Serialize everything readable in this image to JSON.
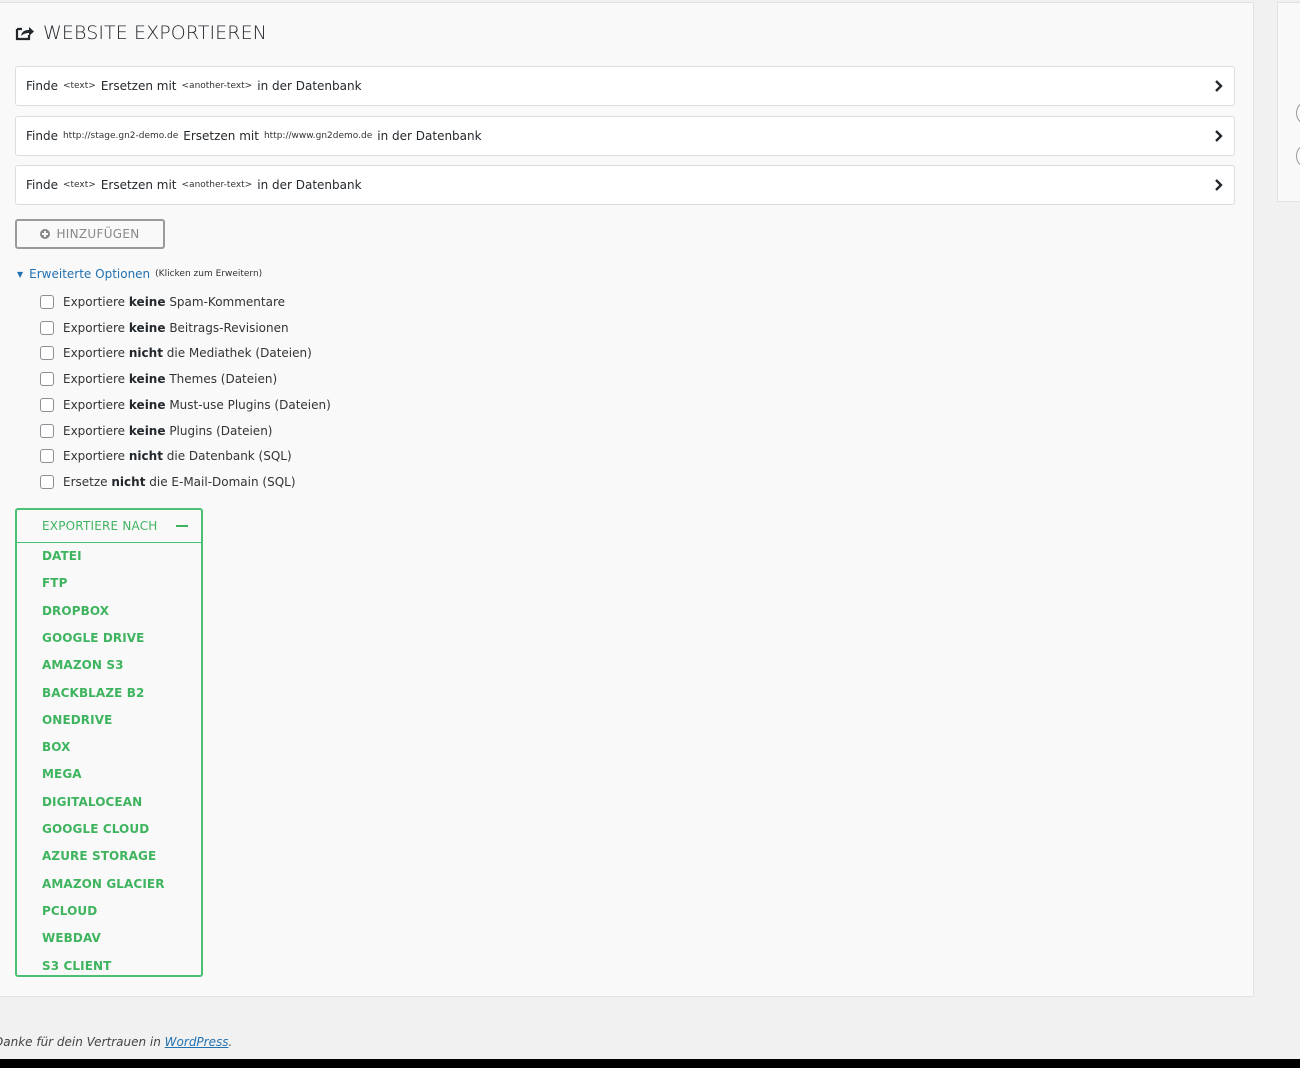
{
  "title": "WEBSITE EXPORTIEREN",
  "replacements": [
    {
      "find_label": "Finde",
      "find_value": "<text>",
      "replace_label": "Ersetzen mit",
      "replace_value": "<another-text>",
      "suffix": "in der Datenbank"
    },
    {
      "find_label": "Finde",
      "find_value": "http://stage.gn2-demo.de",
      "replace_label": "Ersetzen mit",
      "replace_value": "http://www.gn2demo.de",
      "suffix": "in der Datenbank"
    },
    {
      "find_label": "Finde",
      "find_value": "<text>",
      "replace_label": "Ersetzen mit",
      "replace_value": "<another-text>",
      "suffix": "in der Datenbank"
    }
  ],
  "add_button": "HINZUFÜGEN",
  "advanced": {
    "label": "Erweiterte Optionen",
    "hint": "(Klicken zum Erweitern)",
    "options": [
      {
        "pre": "Exportiere",
        "em": "keine",
        "post": "Spam-Kommentare",
        "checked": false
      },
      {
        "pre": "Exportiere",
        "em": "keine",
        "post": "Beitrags-Revisionen",
        "checked": false
      },
      {
        "pre": "Exportiere",
        "em": "nicht",
        "post": "die Mediathek (Dateien)",
        "checked": false
      },
      {
        "pre": "Exportiere",
        "em": "keine",
        "post": "Themes (Dateien)",
        "checked": false
      },
      {
        "pre": "Exportiere",
        "em": "keine",
        "post": "Must-use Plugins (Dateien)",
        "checked": false
      },
      {
        "pre": "Exportiere",
        "em": "keine",
        "post": "Plugins (Dateien)",
        "checked": false
      },
      {
        "pre": "Exportiere",
        "em": "nicht",
        "post": "die Datenbank (SQL)",
        "checked": false
      },
      {
        "pre": "Ersetze",
        "em": "nicht",
        "post": "die E-Mail-Domain (SQL)",
        "checked": false
      }
    ]
  },
  "export_to": {
    "label": "EXPORTIERE NACH",
    "destinations": [
      "DATEI",
      "FTP",
      "DROPBOX",
      "GOOGLE DRIVE",
      "AMAZON S3",
      "BACKBLAZE B2",
      "ONEDRIVE",
      "BOX",
      "MEGA",
      "DIGITALOCEAN",
      "GOOGLE CLOUD",
      "AZURE STORAGE",
      "AMAZON GLACIER",
      "PCLOUD",
      "WEBDAV",
      "S3 CLIENT"
    ]
  },
  "footer": {
    "text": "Danke für dein Vertrauen in",
    "link": "WordPress",
    "end": "."
  },
  "colors": {
    "accent_green": "#3fb45f",
    "link_blue": "#2271b1"
  }
}
